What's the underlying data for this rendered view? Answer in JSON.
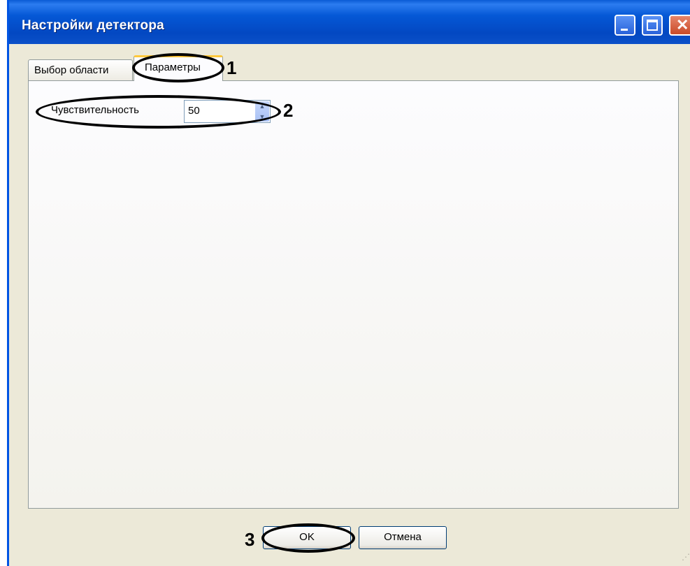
{
  "window": {
    "title": "Настройки детектора",
    "title_buttons": [
      "minimize",
      "maximize",
      "close"
    ]
  },
  "tabs": [
    {
      "label": "Выбор области",
      "selected": false
    },
    {
      "label": "Параметры",
      "selected": true
    }
  ],
  "parameters": {
    "sensitivity_label": "Чувствительность",
    "sensitivity_value": "50"
  },
  "buttons": {
    "ok_label": "OK",
    "cancel_label": "Отмена"
  },
  "callouts": {
    "one": "1",
    "two": "2",
    "three": "3"
  },
  "colors": {
    "titlebar": "#0558D6",
    "window_bg": "#ECE9D8",
    "close_button": "#C94A28",
    "selected_tab_accent": "#FFC83C"
  }
}
